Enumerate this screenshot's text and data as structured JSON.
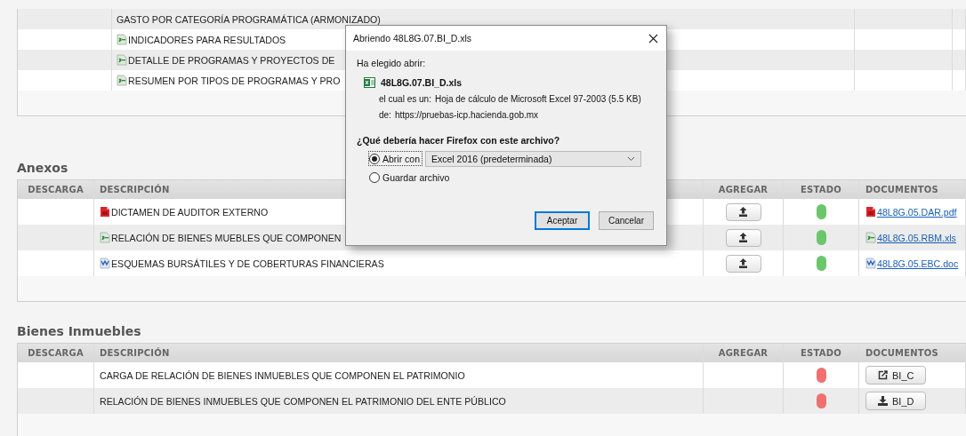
{
  "top_table": {
    "rows": [
      {
        "description": "GASTO POR CATEGORÍA PROGRAMÁTICA (ARMONIZADO)",
        "kind": "plain"
      },
      {
        "description": "INDICADORES PARA RESULTADOS",
        "kind": "spreadsheet"
      },
      {
        "description": "DETALLE DE PROGRAMAS Y PROYECTOS DE",
        "kind": "spreadsheet"
      },
      {
        "description": "RESUMEN POR TIPOS DE PROGRAMAS Y PRO",
        "kind": "spreadsheet"
      }
    ]
  },
  "sections": [
    {
      "title": "Anexos",
      "columns": [
        "DESCARGA",
        "DESCRIPCIÓN",
        "AGREGAR",
        "ESTADO",
        "DOCUMENTOS"
      ],
      "rows": [
        {
          "description": "DICTAMEN DE AUDITOR EXTERNO",
          "kind": "pdf",
          "upload": true,
          "color": "#6cc66c",
          "document": {
            "kind": "link",
            "label": "48L8G.05.DAR.pdf"
          }
        },
        {
          "description": "RELACIÓN DE BIENES MUEBLES QUE COMPONEN",
          "kind": "spreadsheet",
          "upload": true,
          "color": "#6cc66c",
          "document": {
            "kind": "link",
            "label": "48L8G.05.RBM.xls"
          }
        },
        {
          "description": "ESQUEMAS BURSÁTILES Y DE COBERTURAS FINANCIERAS",
          "kind": "document",
          "upload": true,
          "color": "#6cc66c",
          "document": {
            "kind": "link",
            "label": "48L8G.05.EBC.doc"
          }
        }
      ]
    },
    {
      "title": "Bienes Inmuebles",
      "columns": [
        "DESCARGA",
        "DESCRIPCIÓN",
        "AGREGAR",
        "ESTADO",
        "DOCUMENTOS"
      ],
      "rows": [
        {
          "description": "CARGA DE RELACIÓN DE BIENES INMUEBLES QUE COMPONEN EL PATRIMONIO",
          "kind": "plain",
          "upload": false,
          "color": "#f07070",
          "document": {
            "kind": "edit_button",
            "label": "BI_C"
          }
        },
        {
          "description": "RELACIÓN DE BIENES INMUEBLES QUE COMPONEN EL PATRIMONIO DEL ENTE PÚBLICO",
          "kind": "plain",
          "upload": false,
          "color": "#f07070",
          "document": {
            "kind": "download_button",
            "label": "BI_D"
          }
        }
      ]
    }
  ],
  "dialog": {
    "title": "Abriendo 48L8G.07.BI_D.xls",
    "intro": "Ha elegido abrir:",
    "file_name": "48L8G.07.BI_D.xls",
    "type_label": "el cual es un:",
    "type_value": "Hoja de cálculo de Microsoft Excel 97-2003 (5.5 KB)",
    "from_label": "de:",
    "from_value": "https://pruebas-icp.hacienda.gob.mx",
    "question": "¿Qué debería hacer Firefox con este archivo?",
    "options": [
      {
        "label": "Abrir con",
        "selected": true
      },
      {
        "label": "Guardar archivo",
        "selected": false
      }
    ],
    "application": "Excel 2016 (predeterminada)",
    "buttons": [
      {
        "label": "Aceptar",
        "default": true
      },
      {
        "label": "Cancelar",
        "default": false
      }
    ]
  }
}
